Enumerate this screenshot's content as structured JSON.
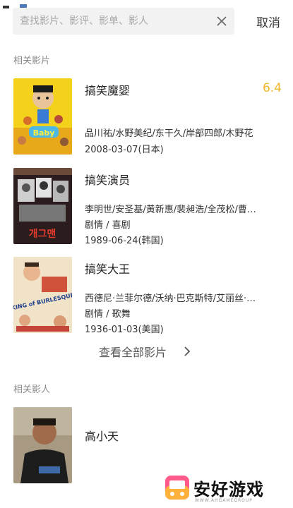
{
  "search": {
    "placeholder": "查找影片、影评、影单、影人",
    "cancel_label": "取消"
  },
  "sections": {
    "movies_title": "相关影片",
    "people_title": "相关影人"
  },
  "movies": [
    {
      "title": "搞笑魔婴",
      "rating": "6.4",
      "cast": "品川祐/水野美纪/东干久/岸部四郎/木野花",
      "genre": "",
      "date": "2008-03-07(日本)",
      "poster_text": "Baby"
    },
    {
      "title": "搞笑演员",
      "rating": "",
      "cast": "李明世/安圣基/黄新惠/裴昶浩/全茂松/曹…",
      "genre": "剧情 / 喜剧",
      "date": "1989-06-24(韩国)",
      "poster_text": "개그맨"
    },
    {
      "title": "搞笑大王",
      "rating": "",
      "cast": "西德尼·兰菲尔德/沃纳·巴克斯特/艾丽丝·…",
      "genre": "剧情 / 歌舞",
      "date": "1936-01-03(美国)",
      "poster_text": "KING of BURLESQUE"
    }
  ],
  "see_all_label": "查看全部影片",
  "people": [
    {
      "name": "高小天"
    }
  ],
  "watermark": {
    "text": "安好游戏",
    "sub": "WWW.AHGAMEGROUP"
  },
  "colors": {
    "rating": "#f1b62b",
    "search_bg": "#f2f2f2",
    "section_title": "#8a8a8a"
  }
}
